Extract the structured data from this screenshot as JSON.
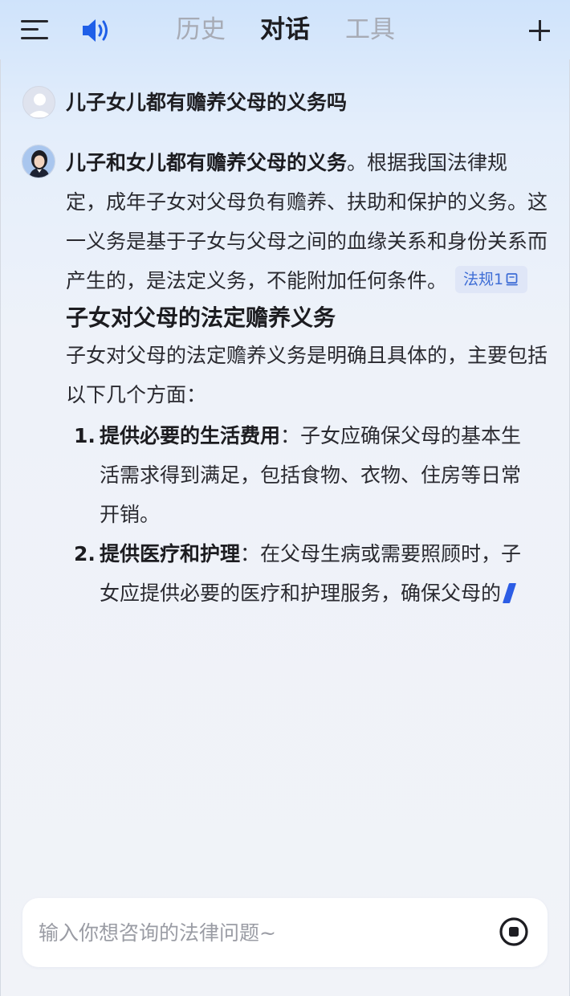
{
  "header": {
    "tabs": [
      {
        "label": "历史",
        "active": false
      },
      {
        "label": "对话",
        "active": true
      },
      {
        "label": "工具",
        "active": false
      }
    ],
    "icons": [
      "menu-icon",
      "speaker-icon",
      "plus-icon"
    ],
    "accent_color": "#1f5fe8"
  },
  "conversation": {
    "user_message": "儿子女儿都有赡养父母的义务吗",
    "answer": {
      "intro_bold": "儿子和女儿都有赡养父母的义务",
      "intro_rest": "。根据我国法律规定，成年子女对父母负有赡养、扶助和保护的义务。这一义务是基于子女与父母之间的血缘关系和身份关系而产生的，是法定义务，不能附加任何条件。",
      "citation_label": "法规1",
      "heading": "子女对父母的法定赡养义务",
      "heading_para": "子女对父母的法定赡养义务是明确且具体的，主要包括以下几个方面：",
      "items": [
        {
          "num": "1.",
          "title": "提供必要的生活费用",
          "text": "：子女应确保父母的基本生活需求得到满足，包括食物、衣物、住房等日常开销。"
        },
        {
          "num": "2.",
          "title": "提供医疗和护理",
          "text": "：在父母生病或需要照顾时，子女应提供必要的医疗和护理服务，确保父母的"
        }
      ]
    }
  },
  "input": {
    "placeholder": "输入你想咨询的法律问题~",
    "value": ""
  }
}
